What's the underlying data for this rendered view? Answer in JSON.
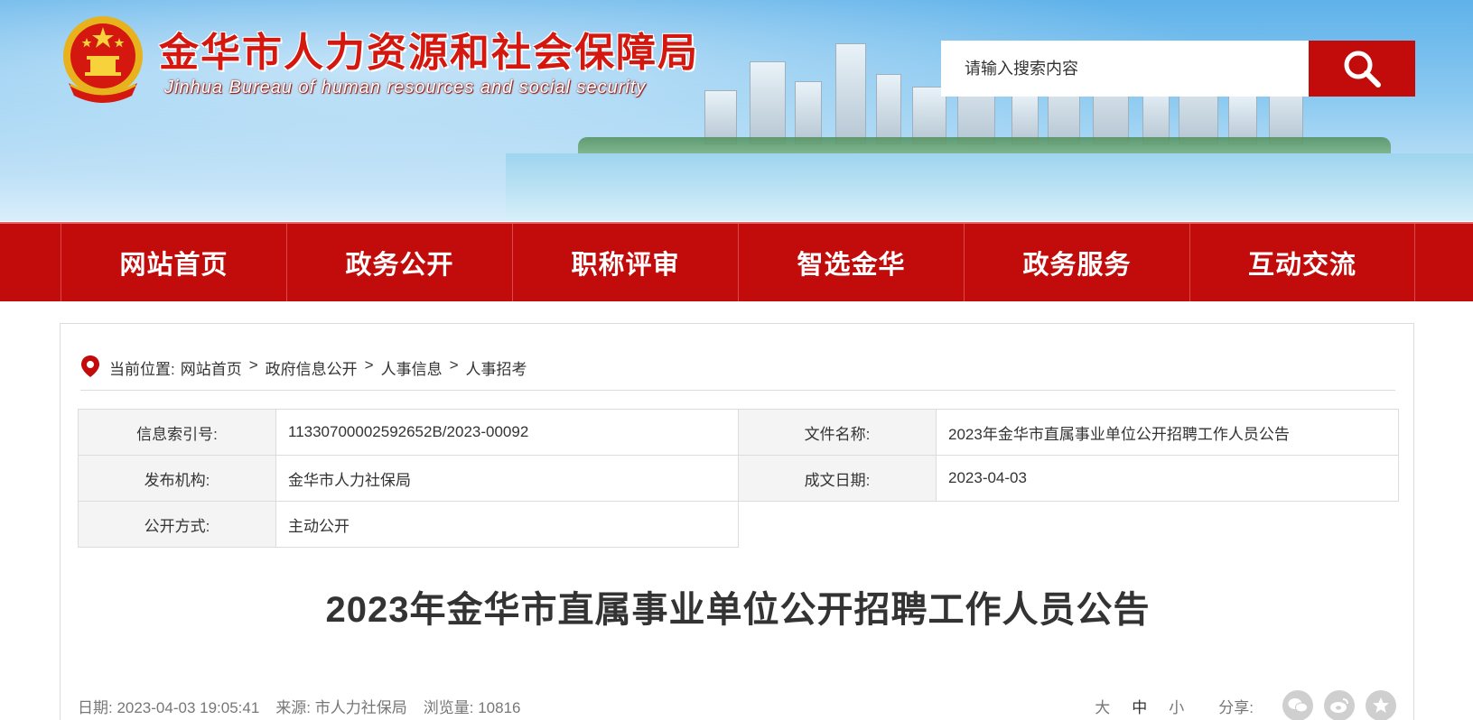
{
  "header": {
    "site_title": "金华市人力资源和社会保障局",
    "site_subtitle": "Jinhua Bureau of human resources and social security",
    "search_placeholder": "请输入搜索内容",
    "brand_color": "#c20c0c"
  },
  "nav": {
    "items": [
      "网站首页",
      "政务公开",
      "职称评审",
      "智选金华",
      "政务服务",
      "互动交流"
    ]
  },
  "breadcrumb": {
    "prefix": "当前位置:",
    "items": [
      "网站首页",
      "政府信息公开",
      "人事信息",
      "人事招考"
    ],
    "separator": ">"
  },
  "meta": {
    "index_label": "信息索引号:",
    "index_value": "11330700002592652B/2023-00092",
    "filename_label": "文件名称:",
    "filename_value": "2023年金华市直属事业单位公开招聘工作人员公告",
    "publisher_label": "发布机构:",
    "publisher_value": "金华市人力社保局",
    "date_label": "成文日期:",
    "date_value": "2023-04-03",
    "disclosure_label": "公开方式:",
    "disclosure_value": "主动公开"
  },
  "article": {
    "title": "2023年金华市直属事业单位公开招聘工作人员公告",
    "date_text": "日期: 2023-04-03 19:05:41",
    "source_text": "来源: 市人力社保局",
    "views_text": "浏览量: 10816",
    "font_sizes": [
      "大",
      "中",
      "小"
    ],
    "share_label": "分享:",
    "share_icons": [
      "wechat-icon",
      "weibo-icon",
      "favorite-icon"
    ]
  }
}
